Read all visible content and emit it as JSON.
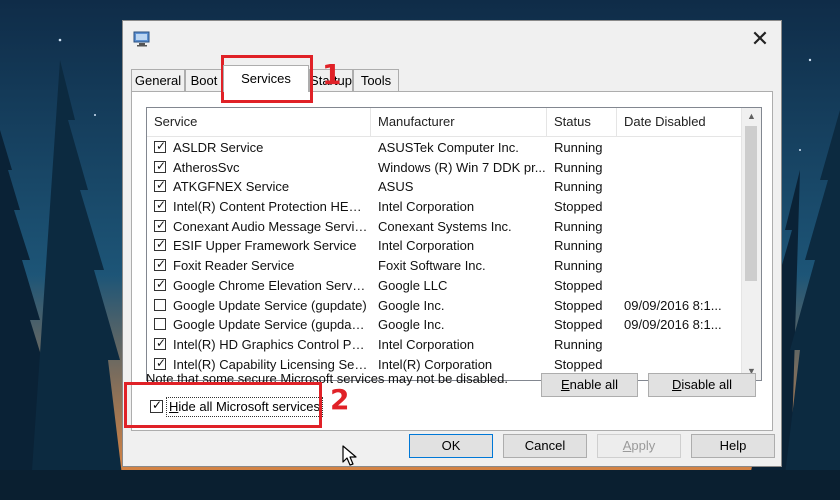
{
  "window": {
    "close_glyph": "✕"
  },
  "tabs": [
    {
      "label": "General"
    },
    {
      "label": "Boot"
    },
    {
      "label": "Services",
      "active": true
    },
    {
      "label": "Startup"
    },
    {
      "label": "Tools"
    }
  ],
  "services_list": {
    "columns": [
      "Service",
      "Manufacturer",
      "Status",
      "Date Disabled"
    ],
    "rows": [
      {
        "checked": true,
        "service": "ASLDR Service",
        "manufacturer": "ASUSTek Computer Inc.",
        "status": "Running",
        "date_disabled": ""
      },
      {
        "checked": true,
        "service": "AtherosSvc",
        "manufacturer": "Windows (R) Win 7 DDK pr...",
        "status": "Running",
        "date_disabled": ""
      },
      {
        "checked": true,
        "service": "ATKGFNEX Service",
        "manufacturer": "ASUS",
        "status": "Running",
        "date_disabled": ""
      },
      {
        "checked": true,
        "service": "Intel(R) Content Protection HEC...",
        "manufacturer": "Intel Corporation",
        "status": "Stopped",
        "date_disabled": ""
      },
      {
        "checked": true,
        "service": "Conexant Audio Message Service",
        "manufacturer": "Conexant Systems Inc.",
        "status": "Running",
        "date_disabled": ""
      },
      {
        "checked": true,
        "service": "ESIF Upper Framework Service",
        "manufacturer": "Intel Corporation",
        "status": "Running",
        "date_disabled": ""
      },
      {
        "checked": true,
        "service": "Foxit Reader Service",
        "manufacturer": "Foxit Software Inc.",
        "status": "Running",
        "date_disabled": ""
      },
      {
        "checked": true,
        "service": "Google Chrome Elevation Service",
        "manufacturer": "Google LLC",
        "status": "Stopped",
        "date_disabled": ""
      },
      {
        "checked": false,
        "service": "Google Update Service (gupdate)",
        "manufacturer": "Google Inc.",
        "status": "Stopped",
        "date_disabled": "09/09/2016 8:1..."
      },
      {
        "checked": false,
        "service": "Google Update Service (gupdatem)",
        "manufacturer": "Google Inc.",
        "status": "Stopped",
        "date_disabled": "09/09/2016 8:1..."
      },
      {
        "checked": true,
        "service": "Intel(R) HD Graphics Control Pa...",
        "manufacturer": "Intel Corporation",
        "status": "Running",
        "date_disabled": ""
      },
      {
        "checked": true,
        "service": "Intel(R) Capability Licensing Ser...",
        "manufacturer": "Intel(R) Corporation",
        "status": "Stopped",
        "date_disabled": ""
      }
    ]
  },
  "note": "Note that some secure Microsoft services may not be disabled.",
  "enable_all": {
    "mnemonic": "E",
    "rest": "nable all"
  },
  "disable_all": {
    "mnemonic": "D",
    "rest": "isable all"
  },
  "hide_ms": {
    "checked": true,
    "mnemonic": "H",
    "rest": "ide all Microsoft services"
  },
  "footer": {
    "ok": "OK",
    "cancel": "Cancel",
    "apply": {
      "mnemonic": "A",
      "rest": "pply"
    },
    "help": "Help"
  },
  "annotations": {
    "one": "1",
    "two": "2",
    "color": "#e02127"
  },
  "colors": {
    "dialog_bg": "#f0f0f0",
    "default_button_border": "#0078d7"
  }
}
